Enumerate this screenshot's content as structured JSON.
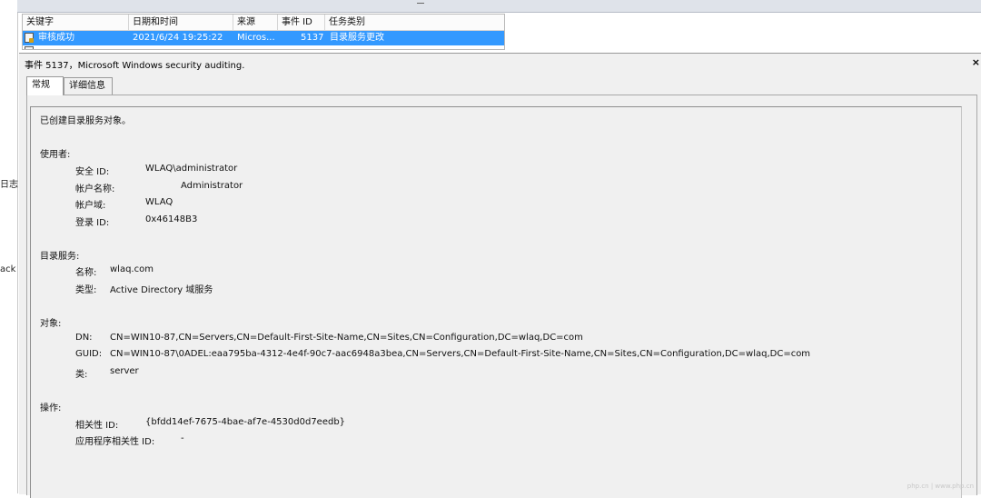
{
  "left_fragments": [
    "日志",
    "ack"
  ],
  "event_list": {
    "columns": [
      "关键字",
      "日期和时间",
      "来源",
      "事件 ID",
      "任务类别"
    ],
    "selected_row": {
      "keyword": "审核成功",
      "datetime": "2021/6/24 19:25:22",
      "source": "Micros...",
      "event_id": "5137",
      "category": "目录服务更改"
    }
  },
  "detail": {
    "title": "事件 5137，Microsoft Windows security auditing.",
    "close": "×",
    "tabs": [
      "常规",
      "详细信息"
    ],
    "message": {
      "intro": "已创建目录服务对象。",
      "subject": {
        "heading": "使用者:",
        "security_id_label": "安全 ID:",
        "security_id": "WLAQ\\administrator",
        "account_name_label": "帐户名称:",
        "account_name": "Administrator",
        "account_domain_label": "帐户域:",
        "account_domain": "WLAQ",
        "logon_id_label": "登录 ID:",
        "logon_id": "0x46148B3"
      },
      "directory_service": {
        "heading": "目录服务:",
        "name_label": "名称:",
        "name": "wlaq.com",
        "type_label": "类型:",
        "type": "Active Directory 域服务"
      },
      "object": {
        "heading": "对象:",
        "dn_label": "DN:",
        "dn": "CN=WIN10-87,CN=Servers,CN=Default-First-Site-Name,CN=Sites,CN=Configuration,DC=wlaq,DC=com",
        "guid_label": "GUID:",
        "guid": "CN=WIN10-87\\0ADEL:eaa795ba-4312-4e4f-90c7-aac6948a3bea,CN=Servers,CN=Default-First-Site-Name,CN=Sites,CN=Configuration,DC=wlaq,DC=com",
        "class_label": "类:",
        "class": "server"
      },
      "operation": {
        "heading": "操作:",
        "correlation_id_label": "相关性 ID:",
        "correlation_id": "{bfdd14ef-7675-4bae-af7e-4530d0d7eedb}",
        "app_correlation_id_label": "应用程序相关性 ID:",
        "app_correlation_id": "-"
      }
    }
  },
  "watermark": "php.cn | www.php.cn"
}
